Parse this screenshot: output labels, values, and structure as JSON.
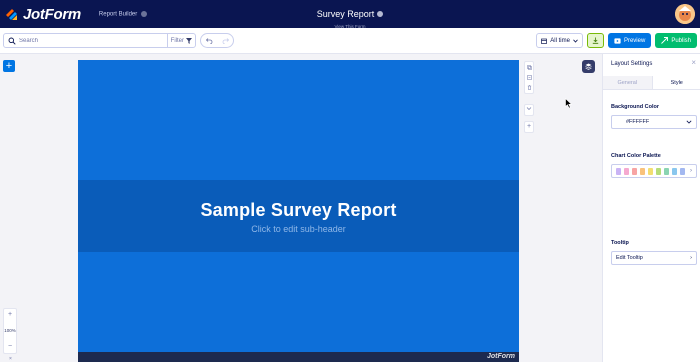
{
  "header": {
    "logo_text": "JotForm",
    "app_name": "Report Builder",
    "title": "Survey Report",
    "subtitle": "View This Form"
  },
  "toolbar": {
    "search_placeholder": "Search",
    "filter_label": "Filter",
    "date_range": "All time",
    "preview_label": "Preview",
    "publish_label": "Publish"
  },
  "canvas": {
    "add_symbol": "+",
    "report_title": "Sample Survey Report",
    "report_subheader": "Click to edit sub-header",
    "footer_brand": "JotForm",
    "zoom": {
      "plus": "+",
      "level": "100%",
      "minus": "−"
    },
    "side_plus": "+",
    "close_symbol": "×"
  },
  "panel": {
    "title": "Layout Settings",
    "close_symbol": "×",
    "tabs": [
      {
        "label": "General",
        "active": false
      },
      {
        "label": "Style",
        "active": true
      }
    ],
    "background_color_label": "Background Color",
    "background_color_value": "#FFFFFF",
    "palette_label": "Chart Color Palette",
    "palette_colors": [
      "#c9b3f5",
      "#f5a9d0",
      "#f7a4a4",
      "#f9c27c",
      "#f2de72",
      "#b6dc7a",
      "#8ad4b2",
      "#8ac7ee",
      "#a3b8f0"
    ],
    "tooltip_label": "Tooltip",
    "tooltip_value": "Edit Tooltip"
  },
  "colors": {
    "topbar": "#0a1551",
    "page_background": "#0d6fd9",
    "header_band": "#0a5cb9",
    "preview": "#0075e3",
    "publish": "#01bd6f"
  }
}
